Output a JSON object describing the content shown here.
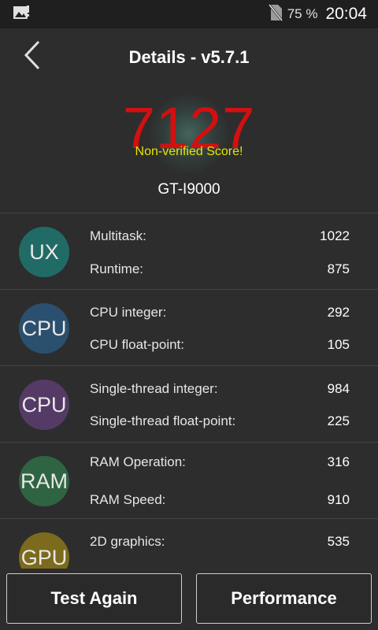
{
  "statusbar": {
    "battery": "75 %",
    "time": "20:04",
    "icons": [
      "gallery-notification-icon",
      "no-sim-icon"
    ]
  },
  "header": {
    "title": "Details - v5.7.1",
    "back_icon": "chevron-left-icon"
  },
  "score": {
    "value": "7127",
    "note": "Non-verified Score!",
    "device": "GT-I9000"
  },
  "categories": [
    {
      "badge": "UX",
      "color": "#216b66",
      "metrics": [
        {
          "label": "Multitask:",
          "value": "1022"
        },
        {
          "label": "Runtime:",
          "value": "875"
        }
      ]
    },
    {
      "badge": "CPU",
      "color": "#2b4f6e",
      "metrics": [
        {
          "label": "CPU integer:",
          "value": "292"
        },
        {
          "label": "CPU float-point:",
          "value": "105"
        }
      ]
    },
    {
      "badge": "CPU",
      "color": "#553a66",
      "metrics": [
        {
          "label": "Single-thread integer:",
          "value": "984"
        },
        {
          "label": "Single-thread float-point:",
          "value": "225"
        }
      ]
    },
    {
      "badge": "RAM",
      "color": "#2f6442",
      "metrics": [
        {
          "label": "RAM Operation:",
          "value": "316"
        },
        {
          "label": "RAM Speed:",
          "value": "910"
        }
      ]
    },
    {
      "badge": "GPU",
      "color": "#7c6a1d",
      "metrics": [
        {
          "label": "2D graphics:",
          "value": "535"
        }
      ]
    }
  ],
  "buttons": {
    "test_again": "Test Again",
    "performance": "Performance"
  }
}
